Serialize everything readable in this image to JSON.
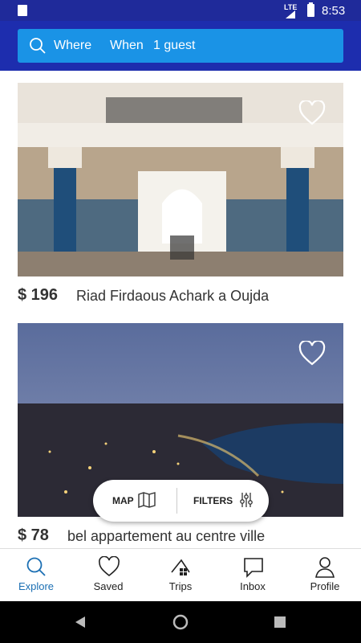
{
  "status_bar": {
    "network": "LTE",
    "time": "8:53"
  },
  "search": {
    "where": "Where",
    "when": "When",
    "guests": "1 guest"
  },
  "listings": [
    {
      "price": "$ 196",
      "title": "Riad Firdaous Achark a Oujda",
      "image": "riad-courtyard-photo"
    },
    {
      "price": "$ 78",
      "title": "bel appartement au centre ville",
      "image": "coastal-city-night-photo"
    }
  ],
  "floating": {
    "map_label": "MAP",
    "filters_label": "FILTERS"
  },
  "nav": [
    {
      "label": "Explore",
      "icon": "search-icon",
      "active": true
    },
    {
      "label": "Saved",
      "icon": "heart-icon"
    },
    {
      "label": "Trips",
      "icon": "trips-icon"
    },
    {
      "label": "Inbox",
      "icon": "message-icon"
    },
    {
      "label": "Profile",
      "icon": "person-icon"
    }
  ],
  "colors": {
    "header": "#1d2dae",
    "search_bar": "#1a93e6",
    "accent": "#1b6fb3"
  }
}
